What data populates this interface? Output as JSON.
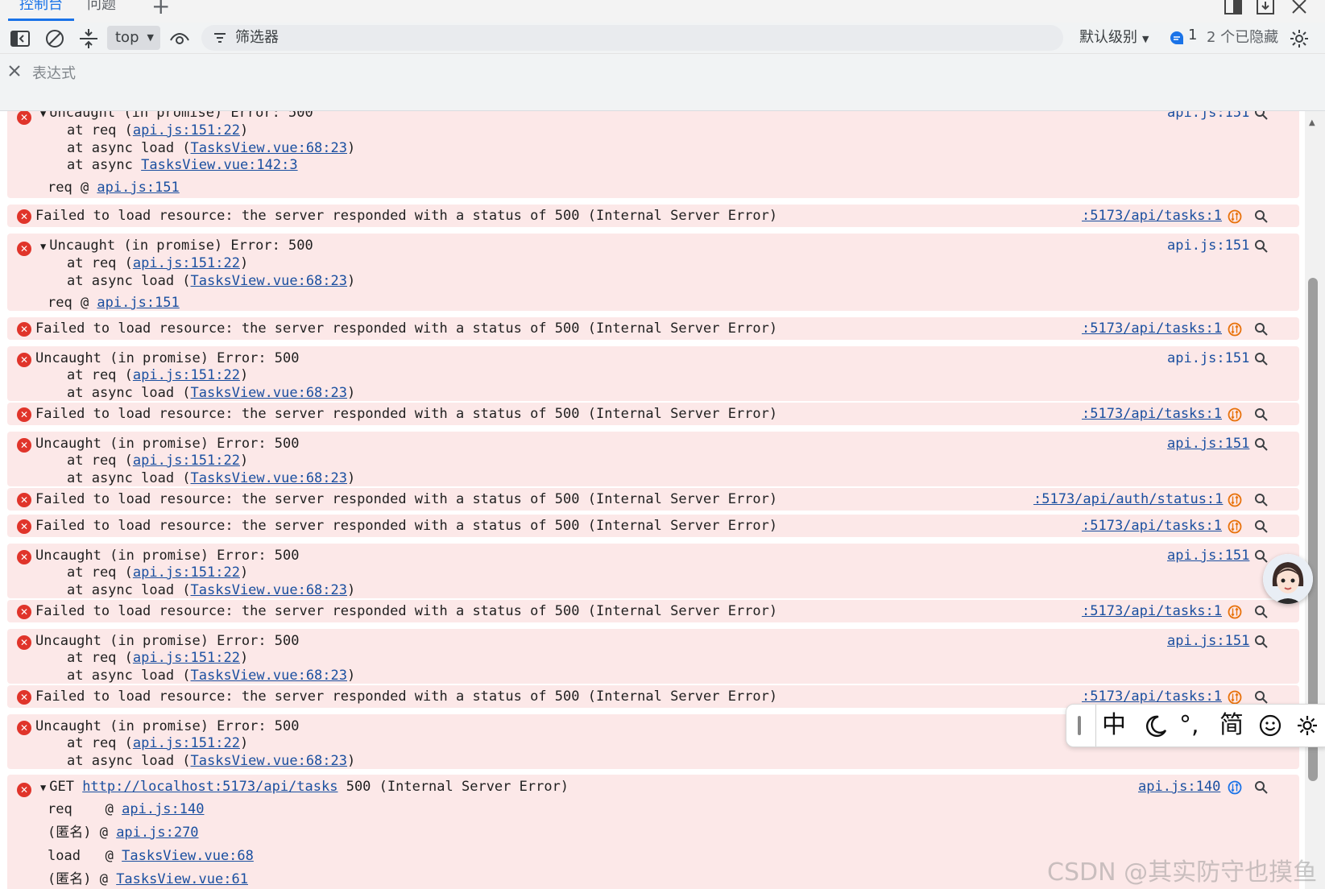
{
  "tabs": [
    {
      "label": "控制台",
      "active": true
    },
    {
      "label": "问题",
      "active": false
    }
  ],
  "toolbar": {
    "context": "top",
    "filter_placeholder": "筛选器",
    "level": "默认级别",
    "issue_count": "1",
    "hidden": "2 个已隐藏"
  },
  "expression": {
    "placeholder": "表达式"
  },
  "colors": {
    "error_bg": "#fce8e8",
    "error_icon": "#e0342a",
    "link": "#1a4fa0",
    "accent": "#1a73e8"
  },
  "console": {
    "failed": "Failed to load resource: the server responded with a status of 500 (Internal Server Error)",
    "uncaught": "Uncaught (in promise) Error: 500",
    "at_req": "at req (",
    "at_load": "at async load (",
    "at_load2": "at async ",
    "req_at": "req @ ",
    "close_paren": ")",
    "link_api15122": "api.js:151:22",
    "link_tasks6823": "TasksView.vue:68:23",
    "link_tasks1423": "TasksView.vue:142:3",
    "link_api151": "api.js:151",
    "src_tasks": ":5173/api/tasks:1",
    "src_auth": ":5173/api/auth/status:1",
    "src_api151": "api.js:151",
    "get_prefix": "GET ",
    "get_url": "http://localhost:5173/api/tasks",
    "get_suffix": " 500 (Internal Server Error)",
    "src_api140": "api.js:140",
    "stack": [
      {
        "fn": "req    @ ",
        "link": "api.js:140"
      },
      {
        "fn": "(匿名) @ ",
        "link": "api.js:270"
      },
      {
        "fn": "load   @ ",
        "link": "TasksView.vue:68"
      },
      {
        "fn": "(匿名) @ ",
        "link": "TasksView.vue:61"
      }
    ]
  },
  "ime": {
    "lang": "中",
    "punct": "°,",
    "simp": "简"
  },
  "watermark": "CSDN @其实防守也摸鱼"
}
